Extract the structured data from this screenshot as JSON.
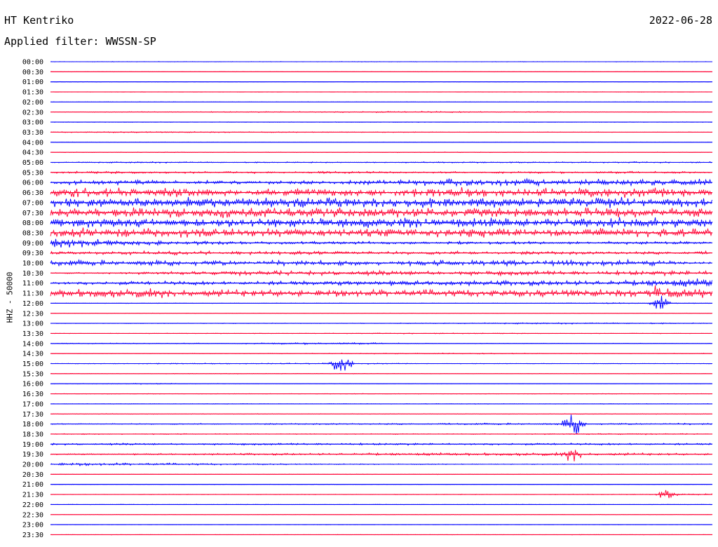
{
  "header": {
    "station": "HT Kentriko",
    "date": "2022-06-28",
    "filter_text": "Applied filter: WWSSN-SP"
  },
  "chart_data": {
    "type": "line",
    "title": "HT Kentriko",
    "ylabel": "HHZ - 50000",
    "colors": [
      "#0000ff",
      "#ff0033"
    ],
    "grid": false,
    "x": [
      0,
      1
    ],
    "rows": [
      {
        "label": "00:00",
        "activity": [
          0.05,
          0.05,
          0.05,
          0.05,
          0.05,
          0.05,
          0.05,
          0.05
        ]
      },
      {
        "label": "00:30",
        "activity": [
          0.04,
          0.04,
          0.04,
          0.04,
          0.04,
          0.04,
          0.04,
          0.05
        ]
      },
      {
        "label": "01:00",
        "activity": [
          0.05,
          0.04,
          0.04,
          0.04,
          0.04,
          0.04,
          0.04,
          0.04
        ]
      },
      {
        "label": "01:30",
        "activity": [
          0.04,
          0.04,
          0.04,
          0.04,
          0.04,
          0.04,
          0.05,
          0.04
        ]
      },
      {
        "label": "02:00",
        "activity": [
          0.04,
          0.04,
          0.04,
          0.04,
          0.04,
          0.04,
          0.04,
          0.04
        ]
      },
      {
        "label": "02:30",
        "activity": [
          0.05,
          0.1,
          0.1,
          0.12,
          0.15,
          0.1,
          0.06,
          0.05
        ]
      },
      {
        "label": "03:00",
        "activity": [
          0.05,
          0.05,
          0.05,
          0.05,
          0.05,
          0.05,
          0.05,
          0.05
        ]
      },
      {
        "label": "03:30",
        "activity": [
          0.08,
          0.12,
          0.1,
          0.08,
          0.06,
          0.05,
          0.05,
          0.05
        ]
      },
      {
        "label": "04:00",
        "activity": [
          0.06,
          0.06,
          0.05,
          0.05,
          0.05,
          0.05,
          0.05,
          0.05
        ]
      },
      {
        "label": "04:30",
        "activity": [
          0.06,
          0.08,
          0.06,
          0.06,
          0.08,
          0.06,
          0.05,
          0.05
        ]
      },
      {
        "label": "05:00",
        "activity": [
          0.08,
          0.15,
          0.1,
          0.1,
          0.12,
          0.12,
          0.12,
          0.12
        ]
      },
      {
        "label": "05:30",
        "activity": [
          0.2,
          0.25,
          0.2,
          0.25,
          0.2,
          0.2,
          0.25,
          0.2
        ]
      },
      {
        "label": "06:00",
        "activity": [
          0.4,
          0.5,
          0.3,
          0.4,
          0.7,
          0.8,
          0.7,
          0.7
        ]
      },
      {
        "label": "06:30",
        "activity": [
          1.0,
          1.0,
          0.8,
          0.8,
          1.0,
          1.0,
          1.0,
          1.0
        ]
      },
      {
        "label": "07:00",
        "activity": [
          1.0,
          1.0,
          1.0,
          1.0,
          1.0,
          1.0,
          1.0,
          1.0
        ]
      },
      {
        "label": "07:30",
        "activity": [
          1.0,
          1.0,
          1.0,
          1.0,
          1.0,
          1.0,
          1.0,
          1.0
        ]
      },
      {
        "label": "08:00",
        "activity": [
          1.0,
          1.0,
          1.0,
          1.0,
          1.0,
          1.0,
          1.0,
          1.0
        ]
      },
      {
        "label": "08:30",
        "activity": [
          1.0,
          1.0,
          0.9,
          0.9,
          0.9,
          0.9,
          0.9,
          0.9
        ]
      },
      {
        "label": "09:00",
        "activity": [
          1.0,
          0.5,
          0.3,
          0.3,
          0.3,
          0.3,
          0.3,
          0.3
        ]
      },
      {
        "label": "09:30",
        "activity": [
          0.3,
          0.4,
          0.35,
          0.35,
          0.35,
          0.35,
          0.35,
          0.35
        ]
      },
      {
        "label": "10:00",
        "activity": [
          0.6,
          0.6,
          0.5,
          0.5,
          0.5,
          0.6,
          0.7,
          0.2
        ]
      },
      {
        "label": "10:30",
        "activity": [
          0.1,
          0.3,
          0.5,
          0.5,
          0.5,
          0.5,
          0.5,
          0.5
        ]
      },
      {
        "label": "11:00",
        "activity": [
          0.3,
          0.4,
          0.4,
          0.5,
          0.5,
          0.5,
          0.5,
          1.0
        ]
      },
      {
        "label": "11:30",
        "activity": [
          0.9,
          0.9,
          0.8,
          0.7,
          0.7,
          0.7,
          0.8,
          1.0
        ]
      },
      {
        "label": "12:00",
        "activity": [
          0.05,
          0.05,
          0.05,
          0.05,
          0.05,
          0.05,
          0.1,
          0.05
        ]
      },
      {
        "label": "12:30",
        "activity": [
          0.05,
          0.05,
          0.05,
          0.05,
          0.05,
          0.05,
          0.05,
          0.05
        ]
      },
      {
        "label": "13:00",
        "activity": [
          0.05,
          0.06,
          0.06,
          0.06,
          0.08,
          0.15,
          0.15,
          0.08
        ]
      },
      {
        "label": "13:30",
        "activity": [
          0.05,
          0.06,
          0.06,
          0.06,
          0.1,
          0.06,
          0.06,
          0.06
        ]
      },
      {
        "label": "14:00",
        "activity": [
          0.08,
          0.12,
          0.1,
          0.25,
          0.06,
          0.06,
          0.06,
          0.05
        ]
      },
      {
        "label": "14:30",
        "activity": [
          0.05,
          0.06,
          0.06,
          0.1,
          0.12,
          0.1,
          0.06,
          0.08
        ]
      },
      {
        "label": "15:00",
        "activity": [
          0.05,
          0.1,
          0.1,
          0.15,
          0.06,
          0.06,
          0.06,
          0.05
        ]
      },
      {
        "label": "15:30",
        "activity": [
          0.05,
          0.05,
          0.08,
          0.05,
          0.05,
          0.05,
          0.05,
          0.05
        ]
      },
      {
        "label": "16:00",
        "activity": [
          0.05,
          0.12,
          0.05,
          0.05,
          0.05,
          0.05,
          0.05,
          0.05
        ]
      },
      {
        "label": "16:30",
        "activity": [
          0.05,
          0.05,
          0.05,
          0.05,
          0.05,
          0.05,
          0.06,
          0.05
        ]
      },
      {
        "label": "17:00",
        "activity": [
          0.05,
          0.06,
          0.06,
          0.06,
          0.06,
          0.06,
          0.06,
          0.06
        ]
      },
      {
        "label": "17:30",
        "activity": [
          0.06,
          0.08,
          0.06,
          0.06,
          0.06,
          0.06,
          0.06,
          0.06
        ]
      },
      {
        "label": "18:00",
        "activity": [
          0.08,
          0.1,
          0.1,
          0.15,
          0.15,
          0.2,
          0.15,
          0.15
        ]
      },
      {
        "label": "18:30",
        "activity": [
          0.1,
          0.1,
          0.08,
          0.08,
          0.08,
          0.1,
          0.15,
          0.08
        ]
      },
      {
        "label": "19:00",
        "activity": [
          0.2,
          0.2,
          0.2,
          0.25,
          0.2,
          0.2,
          0.2,
          0.2
        ]
      },
      {
        "label": "19:30",
        "activity": [
          0.15,
          0.15,
          0.2,
          0.2,
          0.3,
          0.3,
          0.3,
          0.2
        ]
      },
      {
        "label": "20:00",
        "activity": [
          0.3,
          0.25,
          0.15,
          0.1,
          0.1,
          0.08,
          0.06,
          0.06
        ]
      },
      {
        "label": "20:30",
        "activity": [
          0.05,
          0.05,
          0.05,
          0.05,
          0.05,
          0.05,
          0.05,
          0.05
        ]
      },
      {
        "label": "21:00",
        "activity": [
          0.05,
          0.05,
          0.06,
          0.06,
          0.05,
          0.05,
          0.05,
          0.05
        ]
      },
      {
        "label": "21:30",
        "activity": [
          0.05,
          0.05,
          0.05,
          0.05,
          0.06,
          0.06,
          0.06,
          0.2
        ]
      },
      {
        "label": "22:00",
        "activity": [
          0.05,
          0.05,
          0.05,
          0.05,
          0.05,
          0.05,
          0.05,
          0.05
        ]
      },
      {
        "label": "22:30",
        "activity": [
          0.04,
          0.04,
          0.04,
          0.04,
          0.04,
          0.04,
          0.04,
          0.04
        ]
      },
      {
        "label": "23:00",
        "activity": [
          0.04,
          0.04,
          0.04,
          0.04,
          0.04,
          0.04,
          0.04,
          0.04
        ]
      },
      {
        "label": "23:30",
        "activity": [
          0.04,
          0.04,
          0.04,
          0.04,
          0.04,
          0.04,
          0.04,
          0.04
        ]
      }
    ],
    "events": [
      {
        "row": "12:00",
        "x": 0.92,
        "amp": 2.0
      },
      {
        "row": "15:00",
        "x": 0.44,
        "amp": 2.5
      },
      {
        "row": "18:00",
        "x": 0.79,
        "amp": 2.8
      },
      {
        "row": "19:30",
        "x": 0.79,
        "amp": 1.5
      },
      {
        "row": "21:30",
        "x": 0.93,
        "amp": 1.0
      },
      {
        "row": "11:30",
        "x": 0.92,
        "amp": 1.5
      }
    ]
  }
}
